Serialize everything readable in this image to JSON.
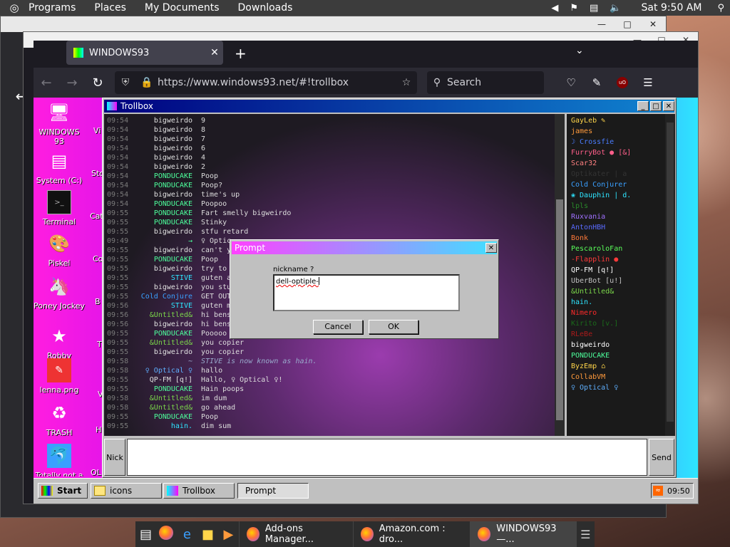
{
  "top_panel": {
    "menus": [
      "Programs",
      "Places",
      "My Documents",
      "Downloads"
    ],
    "clock": "Sat 9:50 AM"
  },
  "browser": {
    "tab_title": "WINDOWS93",
    "url": "https://www.windows93.net/#!trollbox",
    "search_placeholder": "Search"
  },
  "desktop_icons": [
    {
      "label": "WINDOWS 93",
      "icon": "computer-icon"
    },
    {
      "label": "System (C:)",
      "icon": "drive-icon"
    },
    {
      "label": "Terminal",
      "icon": "terminal-icon"
    },
    {
      "label": "Piskel",
      "icon": "palette-icon"
    },
    {
      "label": "Poney Jockey",
      "icon": "pony-icon"
    },
    {
      "label": "Robby",
      "icon": "robot-icon"
    },
    {
      "label": "lenna.png",
      "icon": "image-file-icon"
    },
    {
      "label": "TRASH",
      "icon": "trash-icon"
    },
    {
      "label": "Totally not a virus.Trust",
      "icon": "dolphin-icon"
    }
  ],
  "desktop_icons_cut": [
    "Vi",
    "Sto",
    "Cat",
    "Co",
    "B",
    "T",
    "V",
    "H",
    "OL"
  ],
  "trollbox": {
    "title": "Trollbox",
    "nick_button": "Nick",
    "send_button": "Send",
    "messages": [
      {
        "time": "09:54",
        "nick": "bigweirdo",
        "color": "#e0e0e0",
        "text": "9"
      },
      {
        "time": "09:54",
        "nick": "bigweirdo",
        "color": "#e0e0e0",
        "text": "8"
      },
      {
        "time": "09:54",
        "nick": "bigweirdo",
        "color": "#e0e0e0",
        "text": "7"
      },
      {
        "time": "09:54",
        "nick": "bigweirdo",
        "color": "#e0e0e0",
        "text": "6"
      },
      {
        "time": "09:54",
        "nick": "bigweirdo",
        "color": "#e0e0e0",
        "text": "4"
      },
      {
        "time": "09:54",
        "nick": "bigweirdo",
        "color": "#e0e0e0",
        "text": "2"
      },
      {
        "time": "09:54",
        "nick": "PONDUCAKE",
        "color": "#4dff9c",
        "text": "Poop"
      },
      {
        "time": "09:54",
        "nick": "PONDUCAKE",
        "color": "#4dff9c",
        "text": "Poop?"
      },
      {
        "time": "09:54",
        "nick": "bigweirdo",
        "color": "#e0e0e0",
        "text": "time's up"
      },
      {
        "time": "09:54",
        "nick": "PONDUCAKE",
        "color": "#4dff9c",
        "text": "Poopoo"
      },
      {
        "time": "09:55",
        "nick": "PONDUCAKE",
        "color": "#4dff9c",
        "text": "Fart smelly bigweirdo"
      },
      {
        "time": "09:55",
        "nick": "PONDUCAKE",
        "color": "#4dff9c",
        "text": "Stinky"
      },
      {
        "time": "09:55",
        "nick": "bigweirdo",
        "color": "#e0e0e0",
        "text": "stfu retard"
      },
      {
        "time": "09:49",
        "nick": "→",
        "color": "#4dff9c",
        "text": "♀ Optic"
      },
      {
        "time": "09:55",
        "nick": "bigweirdo",
        "color": "#e0e0e0",
        "text": "can't y"
      },
      {
        "time": "09:55",
        "nick": "PONDUCAKE",
        "color": "#4dff9c",
        "text": "Poop"
      },
      {
        "time": "09:55",
        "nick": "bigweirdo",
        "color": "#e0e0e0",
        "text": "try to"
      },
      {
        "time": "09:55",
        "nick": "STIVE",
        "color": "#2ee5ff",
        "text": "guten a"
      },
      {
        "time": "09:55",
        "nick": "bigweirdo",
        "color": "#e0e0e0",
        "text": "you stu"
      },
      {
        "time": "09:55",
        "nick": "Cold Conjure",
        "color": "#3aa0ff",
        "text": "GET OUT"
      },
      {
        "time": "09:56",
        "nick": "STIVE",
        "color": "#2ee5ff",
        "text": "guten m"
      },
      {
        "time": "09:56",
        "nick": "&Untitled&",
        "color": "#7bd64a",
        "text": "hi bens"
      },
      {
        "time": "09:56",
        "nick": "bigweirdo",
        "color": "#e0e0e0",
        "text": "hi bens"
      },
      {
        "time": "09:55",
        "nick": "PONDUCAKE",
        "color": "#4dff9c",
        "text": "Pooooo"
      },
      {
        "time": "09:55",
        "nick": "&Untitled&",
        "color": "#7bd64a",
        "text": "you copier"
      },
      {
        "time": "09:55",
        "nick": "bigweirdo",
        "color": "#e0e0e0",
        "text": "you copier"
      },
      {
        "time": "09:58",
        "nick": "~",
        "color": "#9ac",
        "text": "STIVE is now known as hain.",
        "system": true
      },
      {
        "time": "09:58",
        "nick": "♀ Optical ♀",
        "color": "#5fb0ff",
        "text": "hallo"
      },
      {
        "time": "09:55",
        "nick": "QP-FM [q!]",
        "color": "#e0e0e0",
        "text": "Hallo, ♀ Optical ♀!"
      },
      {
        "time": "09:55",
        "nick": "PONDUCAKE",
        "color": "#4dff9c",
        "text": "Hain poops"
      },
      {
        "time": "09:58",
        "nick": "&Untitled&",
        "color": "#7bd64a",
        "text": "im dum"
      },
      {
        "time": "09:58",
        "nick": "&Untitled&",
        "color": "#7bd64a",
        "text": "go ahead"
      },
      {
        "time": "09:55",
        "nick": "PONDUCAKE",
        "color": "#4dff9c",
        "text": "Poop"
      },
      {
        "time": "09:55",
        "nick": "hain.",
        "color": "#2ee5ff",
        "text": "dim sum"
      }
    ],
    "users": [
      {
        "name": "GayLeb ✎",
        "color": "#ffd54a"
      },
      {
        "name": "james",
        "color": "#ff9a3c"
      },
      {
        "name": "☽ Crossfie",
        "color": "#4a7dff"
      },
      {
        "name": "FurryBot ● [&]",
        "color": "#ff5f8a"
      },
      {
        "name": "Scar32",
        "color": "#ff8080"
      },
      {
        "name": "Optikater | a",
        "color": "#333333"
      },
      {
        "name": "Cold Conjurer",
        "color": "#3aa0ff"
      },
      {
        "name": "❀ Dauphin | d.",
        "color": "#2ee5ff"
      },
      {
        "name": "lpls",
        "color": "#2a8a2a"
      },
      {
        "name": "Ruxvania",
        "color": "#a070ff"
      },
      {
        "name": "AntonHBH",
        "color": "#5a6bff"
      },
      {
        "name": "Bonk",
        "color": "#ff7a3a"
      },
      {
        "name": "PescaroloFan",
        "color": "#5aff5a"
      },
      {
        "name": "-Flapplin ●",
        "color": "#ff3a3a"
      },
      {
        "name": "QP-FM [q!]",
        "color": "#ffffff"
      },
      {
        "name": "UberBot [u!]",
        "color": "#c0c0c0"
      },
      {
        "name": "&Untitled&",
        "color": "#7bd64a"
      },
      {
        "name": "hain.",
        "color": "#2ee5ff"
      },
      {
        "name": "Nimero",
        "color": "#ff2a2a"
      },
      {
        "name": "Kirito [v.]",
        "color": "#1a6a1a"
      },
      {
        "name": "RLeBe",
        "color": "#aa1a1a"
      },
      {
        "name": "bigweirdo",
        "color": "#ffffff"
      },
      {
        "name": "PONDUCAKE",
        "color": "#4dff9c"
      },
      {
        "name": "ByzEmp ⌂",
        "color": "#ffd54a"
      },
      {
        "name": "CollabVM",
        "color": "#ff9a3c"
      },
      {
        "name": "♀ Optical ♀",
        "color": "#5fb0ff"
      }
    ]
  },
  "prompt": {
    "title": "Prompt",
    "question": "nickname ?",
    "value": "dell-optiple-",
    "cancel": "Cancel",
    "ok": "OK"
  },
  "w93_taskbar": {
    "start": "Start",
    "tasks": [
      "icons",
      "Trollbox",
      "Prompt"
    ],
    "clock": "09:50"
  },
  "dock": {
    "windows": [
      "Add-ons Manager...",
      "Amazon.com : dro...",
      "WINDOWS93 —..."
    ]
  }
}
